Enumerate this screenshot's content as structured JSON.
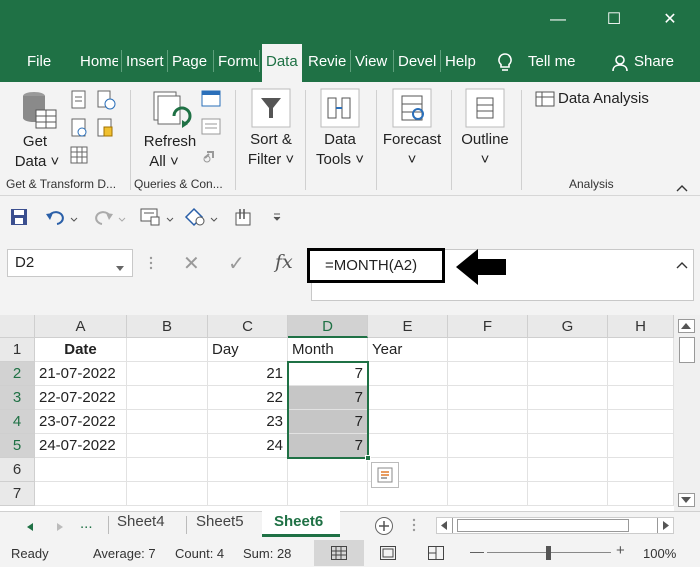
{
  "window": {
    "minimize": "—",
    "maximize": "☐",
    "close": "✕"
  },
  "ribbon_tabs": [
    {
      "label": "File"
    },
    {
      "label": "Home"
    },
    {
      "label": "Insert"
    },
    {
      "label": "Page L"
    },
    {
      "label": "Formu"
    },
    {
      "label": "Data"
    },
    {
      "label": "Revie"
    },
    {
      "label": "View"
    },
    {
      "label": "Devel"
    },
    {
      "label": "Help"
    }
  ],
  "tellme": "Tell me",
  "share": "Share",
  "ribbon": {
    "get_data": [
      "Get",
      "Data ˅"
    ],
    "refresh_all": [
      "Refresh",
      "All ˅"
    ],
    "sort_filter": [
      "Sort &",
      "Filter ˅"
    ],
    "data_tools": [
      "Data",
      "Tools ˅"
    ],
    "forecast": [
      "Forecast",
      "˅"
    ],
    "outline": [
      "Outline",
      "˅"
    ],
    "data_analysis": "Data Analysis",
    "groups": {
      "get_transform": "Get & Transform D...",
      "queries": "Queries & Con...",
      "analysis": "Analysis"
    }
  },
  "formula_bar": {
    "name_box": "D2",
    "cancel": "✕",
    "enter": "✓",
    "fx": "fx",
    "formula": "=MONTH(A2)"
  },
  "columns": [
    "A",
    "B",
    "C",
    "D",
    "E",
    "F",
    "G",
    "H"
  ],
  "rows": [
    {
      "n": "1",
      "A": "Date",
      "B": "",
      "C": "Day",
      "D": "Month",
      "E": "Year"
    },
    {
      "n": "2",
      "A": "21-07-2022",
      "B": "",
      "C": "21",
      "D": "7",
      "E": ""
    },
    {
      "n": "3",
      "A": "22-07-2022",
      "B": "",
      "C": "22",
      "D": "7",
      "E": ""
    },
    {
      "n": "4",
      "A": "23-07-2022",
      "B": "",
      "C": "23",
      "D": "7",
      "E": ""
    },
    {
      "n": "5",
      "A": "24-07-2022",
      "B": "",
      "C": "24",
      "D": "7",
      "E": ""
    },
    {
      "n": "6",
      "A": "",
      "B": "",
      "C": "",
      "D": "",
      "E": ""
    },
    {
      "n": "7",
      "A": "",
      "B": "",
      "C": "",
      "D": "",
      "E": ""
    }
  ],
  "sheets": {
    "more": "...",
    "tabs": [
      "Sheet4",
      "Sheet5",
      "Sheet6"
    ],
    "active": "Sheet6"
  },
  "status": {
    "mode": "Ready",
    "average": "Average: 7",
    "count": "Count: 4",
    "sum": "Sum: 28",
    "zoom": "100%",
    "minus": "—",
    "plus": "+"
  },
  "colors": {
    "accent": "#1f7145",
    "selection": "#c6c6c6"
  }
}
